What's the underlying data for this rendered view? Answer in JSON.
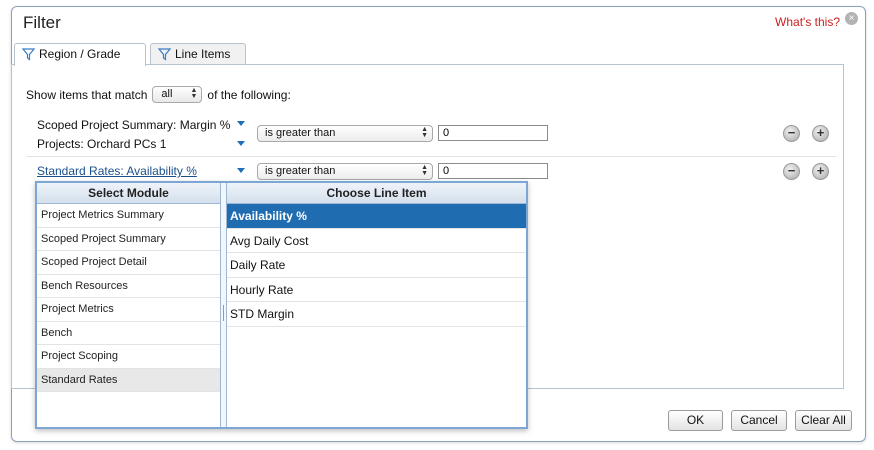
{
  "dialog": {
    "title": "Filter",
    "help_link": "What's this?",
    "close_glyph": "×"
  },
  "tabs": [
    {
      "label": "Region / Grade",
      "icon": "funnel-icon",
      "active": true
    },
    {
      "label": "Line Items",
      "icon": "funnel-icon",
      "active": false
    }
  ],
  "match": {
    "prefix": "Show items that match",
    "value": "all",
    "suffix": "of the following:"
  },
  "rows": [
    {
      "label_line1": "Scoped Project Summary: Margin %",
      "label_line2": "Projects: Orchard PCs 1",
      "condition": "is greater than",
      "value": "0"
    },
    {
      "label_line1": "Standard Rates: Availability %",
      "condition": "is greater than",
      "value": "0"
    }
  ],
  "popup": {
    "module_header": "Select Module",
    "line_header": "Choose Line Item",
    "modules": [
      "Project Metrics Summary",
      "Scoped Project Summary",
      "Scoped Project Detail",
      "Bench Resources",
      "Project Metrics",
      "Bench",
      "Project Scoping",
      "Standard Rates"
    ],
    "selected_module": "Standard Rates",
    "line_items": [
      "Availability %",
      "Avg Daily Cost",
      "Daily Rate",
      "Hourly Rate",
      "STD Margin"
    ],
    "selected_line_item": "Availability %"
  },
  "buttons": {
    "ok": "OK",
    "cancel": "Cancel",
    "clear_all": "Clear All"
  },
  "colors": {
    "accent_selected": "#1f6cb0",
    "help_link": "#cc1f1f",
    "link": "#1a4f8b"
  }
}
